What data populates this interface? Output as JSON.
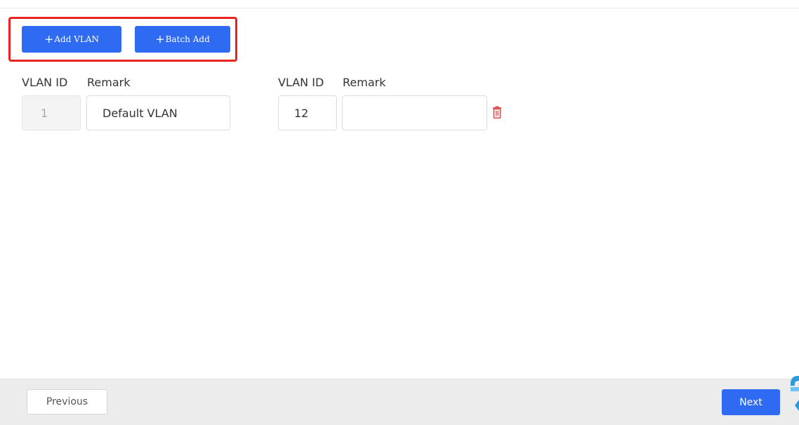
{
  "toolbar": {
    "add_vlan_icon": "+",
    "add_vlan_label": "Add VLAN",
    "batch_add_icon": "+",
    "batch_add_label": "Batch Add"
  },
  "vlan_entries": [
    {
      "vlan_id_label": "VLAN ID",
      "remark_label": "Remark",
      "vlan_id_value": "1",
      "remark_value": "Default VLAN",
      "vlan_id_disabled": true,
      "deletable": false
    },
    {
      "vlan_id_label": "VLAN ID",
      "remark_label": "Remark",
      "vlan_id_value": "12",
      "remark_value": "",
      "vlan_id_disabled": false,
      "deletable": true
    }
  ],
  "icons": {
    "delete": "trash-icon",
    "float_widget": "support-widget-icon"
  },
  "footer": {
    "previous_label": "Previous",
    "next_label": "Next"
  },
  "colors": {
    "primary": "#2e6bf2",
    "highlight_border": "#e8231f",
    "delete": "#e04b4b",
    "footer_bg": "#ececec"
  }
}
